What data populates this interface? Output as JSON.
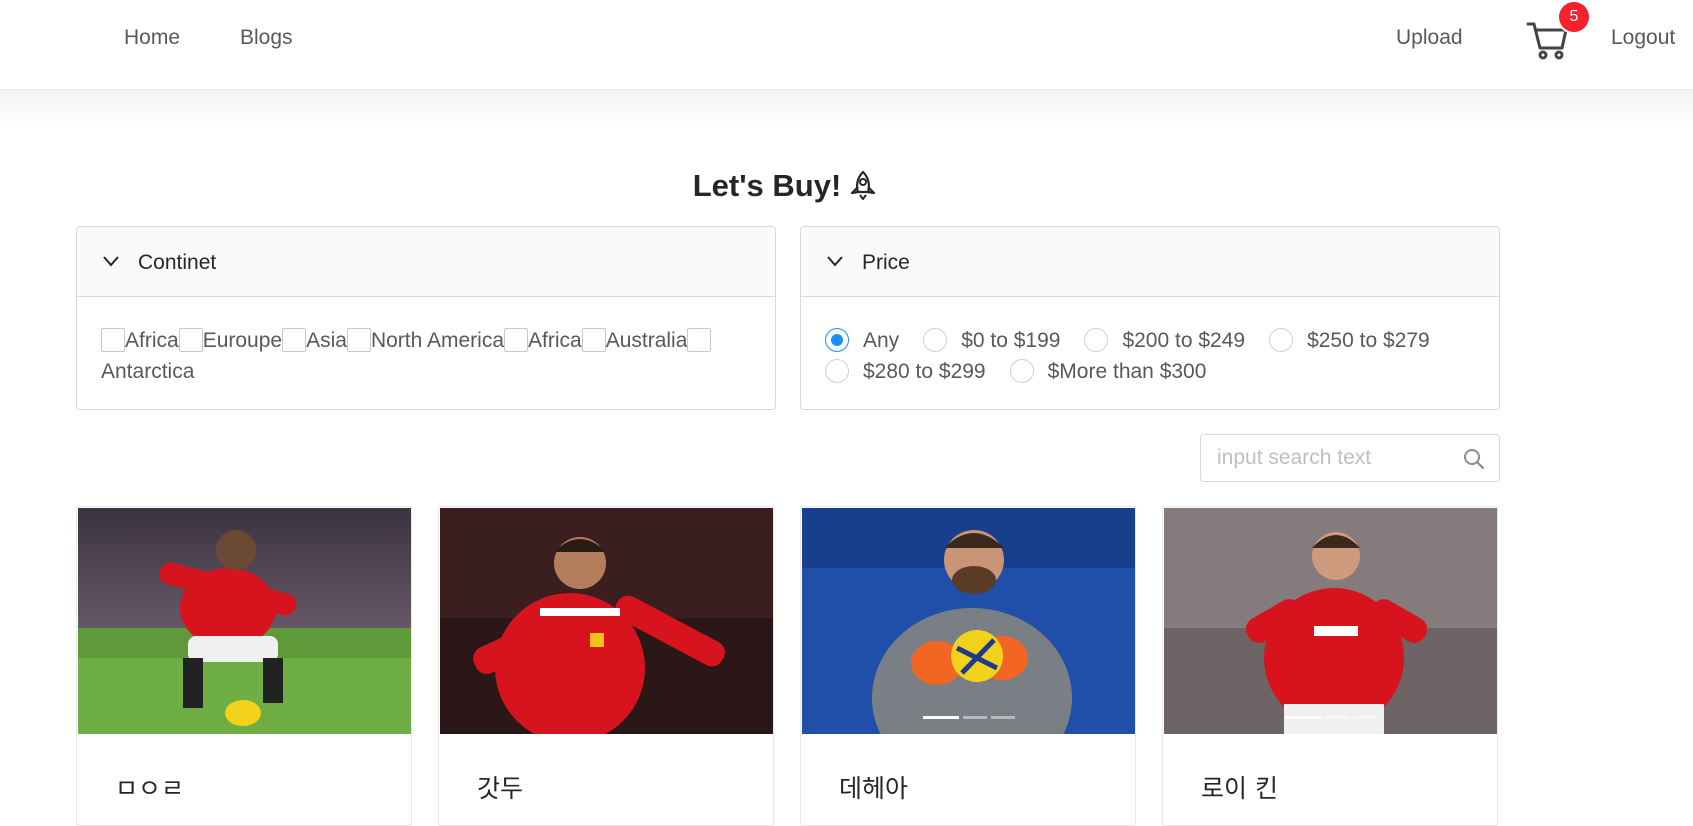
{
  "nav": {
    "home": "Home",
    "blogs": "Blogs",
    "upload": "Upload",
    "cart_count": "5",
    "logout": "Logout"
  },
  "page_title": "Let's Buy!",
  "continent_panel": {
    "label": "Continet",
    "options": [
      "Africa",
      "Euroupe",
      "Asia",
      "North America",
      "Africa",
      "Australia",
      "Antarctica"
    ]
  },
  "price_panel": {
    "label": "Price",
    "selected": "Any",
    "options": [
      "Any",
      "$0 to $199",
      "$200 to $249",
      "$250 to $279",
      "$280 to $299",
      "$More than $300"
    ]
  },
  "search": {
    "placeholder": "input search text"
  },
  "cards": [
    {
      "title": "ㅁㅇㄹ",
      "carousel_dots": 0
    },
    {
      "title": "갓두",
      "carousel_dots": 0
    },
    {
      "title": "데헤아",
      "carousel_dots": 3,
      "active_dot": 0
    },
    {
      "title": "로이 킨",
      "carousel_dots": 3,
      "active_dot": 0
    }
  ],
  "colors": {
    "accent": "#1890ff",
    "badge": "#f5222d",
    "jersey_red": "#d7141e"
  },
  "icons": [
    "cart-icon",
    "rocket-icon",
    "chevron-down-icon",
    "search-icon"
  ]
}
